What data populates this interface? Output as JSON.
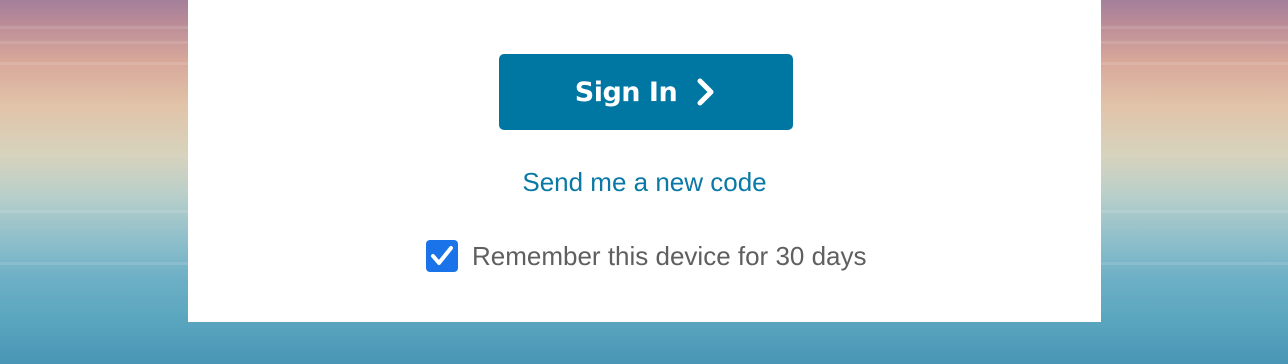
{
  "signin": {
    "button_label": "Sign In",
    "link_label": "Send me a new code",
    "remember_label": "Remember this device for 30 days",
    "remember_checked": true
  },
  "colors": {
    "button": "#0076a3",
    "link": "#0a79a6",
    "checkbox": "#1a73e8",
    "card": "#ffffff"
  },
  "icons": {
    "button_icon": "chevron-right-icon",
    "checkbox_icon": "checkmark-icon"
  }
}
